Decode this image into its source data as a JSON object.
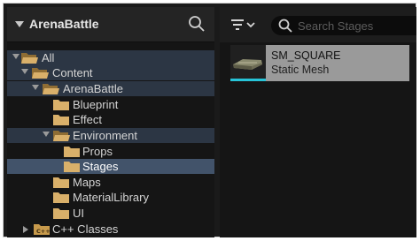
{
  "left_panel": {
    "title": "ArenaBattle",
    "search_icon": "search-icon",
    "tree": [
      {
        "label": "All",
        "expanded": true
      },
      {
        "label": "Content",
        "expanded": true
      },
      {
        "label": "ArenaBattle",
        "expanded": true
      },
      {
        "label": "Blueprint"
      },
      {
        "label": "Effect"
      },
      {
        "label": "Environment",
        "expanded": true
      },
      {
        "label": "Props"
      },
      {
        "label": "Stages",
        "selected": true
      },
      {
        "label": "Maps"
      },
      {
        "label": "MaterialLibrary"
      },
      {
        "label": "UI"
      },
      {
        "label": "C++ Classes",
        "expanded": false
      }
    ]
  },
  "right_panel": {
    "filter_icon": "filter-icon",
    "search": {
      "placeholder": "Search Stages",
      "value": ""
    },
    "assets": [
      {
        "name": "SM_SQUARE",
        "type": "Static Mesh"
      }
    ]
  },
  "colors": {
    "folder": "#d9b06a",
    "selection": "#42536a",
    "asset_accent": "#27c4d8"
  }
}
